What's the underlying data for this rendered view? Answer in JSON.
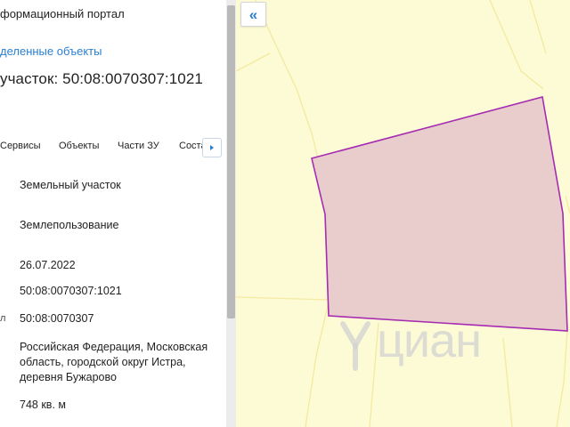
{
  "portal": {
    "title": "формационный портал",
    "selected_objects_link": "деленные объекты",
    "parcel_heading": "участок: 50:08:0070307:1021"
  },
  "tabs": [
    {
      "label": "Сервисы"
    },
    {
      "label": "Объекты"
    },
    {
      "label": "Части ЗУ"
    },
    {
      "label": "Соста"
    }
  ],
  "properties": [
    {
      "marker": "",
      "value": "Земельный участок"
    },
    {
      "marker": "",
      "value": "Землепользование"
    },
    {
      "marker": "",
      "value": "26.07.2022"
    },
    {
      "marker": "",
      "value": "50:08:0070307:1021"
    },
    {
      "marker": "л",
      "value": "50:08:0070307"
    },
    {
      "marker": "",
      "value": "Российская Федерация, Московская область, городской округ Истра, деревня Бужарово"
    },
    {
      "marker": "",
      "value": "748 кв. м"
    }
  ],
  "map": {
    "watermark": "циан",
    "background_color": "#fdfbd5",
    "parcel_fill": "#e8cdcc",
    "parcel_stroke": "#a62bb3",
    "collapse_icon": "double-chevron-left-icon"
  }
}
